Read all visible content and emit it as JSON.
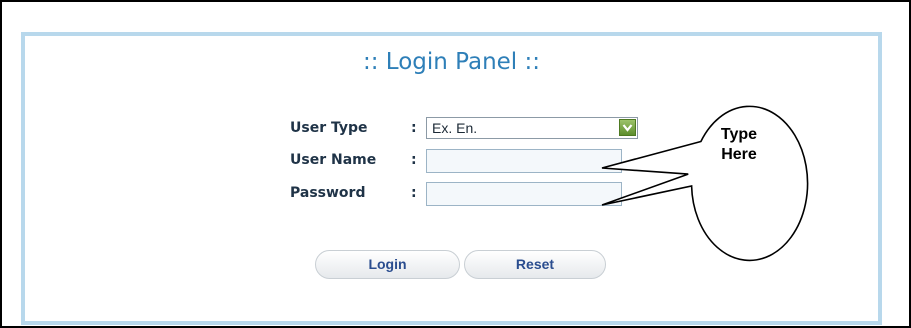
{
  "panel": {
    "title": ":: Login Panel ::"
  },
  "form": {
    "user_type": {
      "label": "User Type",
      "colon": ":",
      "selected": "Ex. En."
    },
    "user_name": {
      "label": "User Name",
      "colon": ":",
      "value": ""
    },
    "password": {
      "label": "Password",
      "colon": ":",
      "value": ""
    }
  },
  "buttons": {
    "login": "Login",
    "reset": "Reset"
  },
  "callout": {
    "line1": "Type",
    "line2": "Here"
  },
  "colors": {
    "panel_border": "#b8d8ec",
    "title": "#2e7fb8",
    "label": "#1f3347",
    "button_text": "#2a4d8f",
    "dropdown_arrow": "#5d8e2e"
  },
  "icons": {
    "dropdown": "chevron-down-icon"
  }
}
